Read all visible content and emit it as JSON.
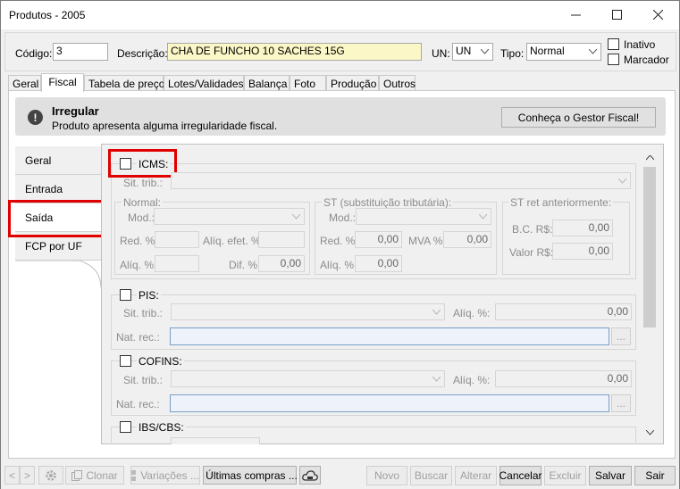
{
  "window": {
    "title": "Produtos - 2005",
    "minimize_icon": "minimize-icon",
    "maximize_icon": "maximize-icon",
    "close_icon": "close-icon"
  },
  "header": {
    "codigo_label": "Código:",
    "codigo_value": "3",
    "descricao_label": "Descrição:",
    "descricao_value": "CHA DE FUNCHO 10 SACHES 15G",
    "un_label": "UN:",
    "un_value": "UN",
    "tipo_label": "Tipo:",
    "tipo_value": "Normal",
    "inativo_label": "Inativo",
    "marcador_label": "Marcador"
  },
  "tabs": [
    "Geral",
    "Fiscal",
    "Tabela de preço",
    "Lotes/Validades",
    "Balança",
    "Foto",
    "Produção",
    "Outros"
  ],
  "banner": {
    "title": "Irregular",
    "message": "Produto apresenta alguma irregularidade fiscal.",
    "button": "Conheça o Gestor Fiscal!"
  },
  "side_tabs": [
    "Geral",
    "Entrada",
    "Saída",
    "FCP por UF"
  ],
  "icms": {
    "label": "ICMS:",
    "sit_trib_label": "Sit. trib.:",
    "normal": {
      "label": "Normal:",
      "mod_label": "Mod.:",
      "red_label": "Red. %:",
      "aliq_efet_label": "Alíq. efet. %:",
      "aliq_label": "Alíq. %:",
      "dif_label": "Dif. %:",
      "dif_value": "0,00"
    },
    "st": {
      "label": "ST (substituição tributária):",
      "mod_label": "Mod.:",
      "red_label": "Red. %:",
      "red_value": "0,00",
      "mva_label": "MVA %:",
      "mva_value": "0,00",
      "aliq_label": "Alíq. %:",
      "aliq_value": "0,00"
    },
    "st_ret": {
      "label": "ST ret anteriormente:",
      "bc_label": "B.C. R$:",
      "bc_value": "0,00",
      "valor_label": "Valor R$:",
      "valor_value": "0,00"
    }
  },
  "pis": {
    "label": "PIS:",
    "sit_trib_label": "Sit. trib.:",
    "aliq_label": "Alíq. %:",
    "aliq_value": "0,00",
    "nat_rec_label": "Nat. rec.:",
    "ellipsis": "..."
  },
  "cofins": {
    "label": "COFINS:",
    "sit_trib_label": "Sit. trib.:",
    "aliq_label": "Alíq. %:",
    "aliq_value": "0,00",
    "nat_rec_label": "Nat. rec.:",
    "ellipsis": "..."
  },
  "ibs": {
    "label": "IBS/CBS:"
  },
  "bottom": {
    "prev": "<",
    "next": ">",
    "clonar": "Clonar",
    "variacoes": "Variações ...",
    "ultimas": "Últimas compras ...",
    "novo": "Novo",
    "buscar": "Buscar",
    "alterar": "Alterar",
    "cancelar": "Cancelar",
    "excluir": "Excluir",
    "salvar": "Salvar",
    "sair": "Sair"
  },
  "colors": {
    "highlight": "#e00000",
    "yellow_field": "#fbf7c6",
    "banner": "#e0e0e0"
  }
}
